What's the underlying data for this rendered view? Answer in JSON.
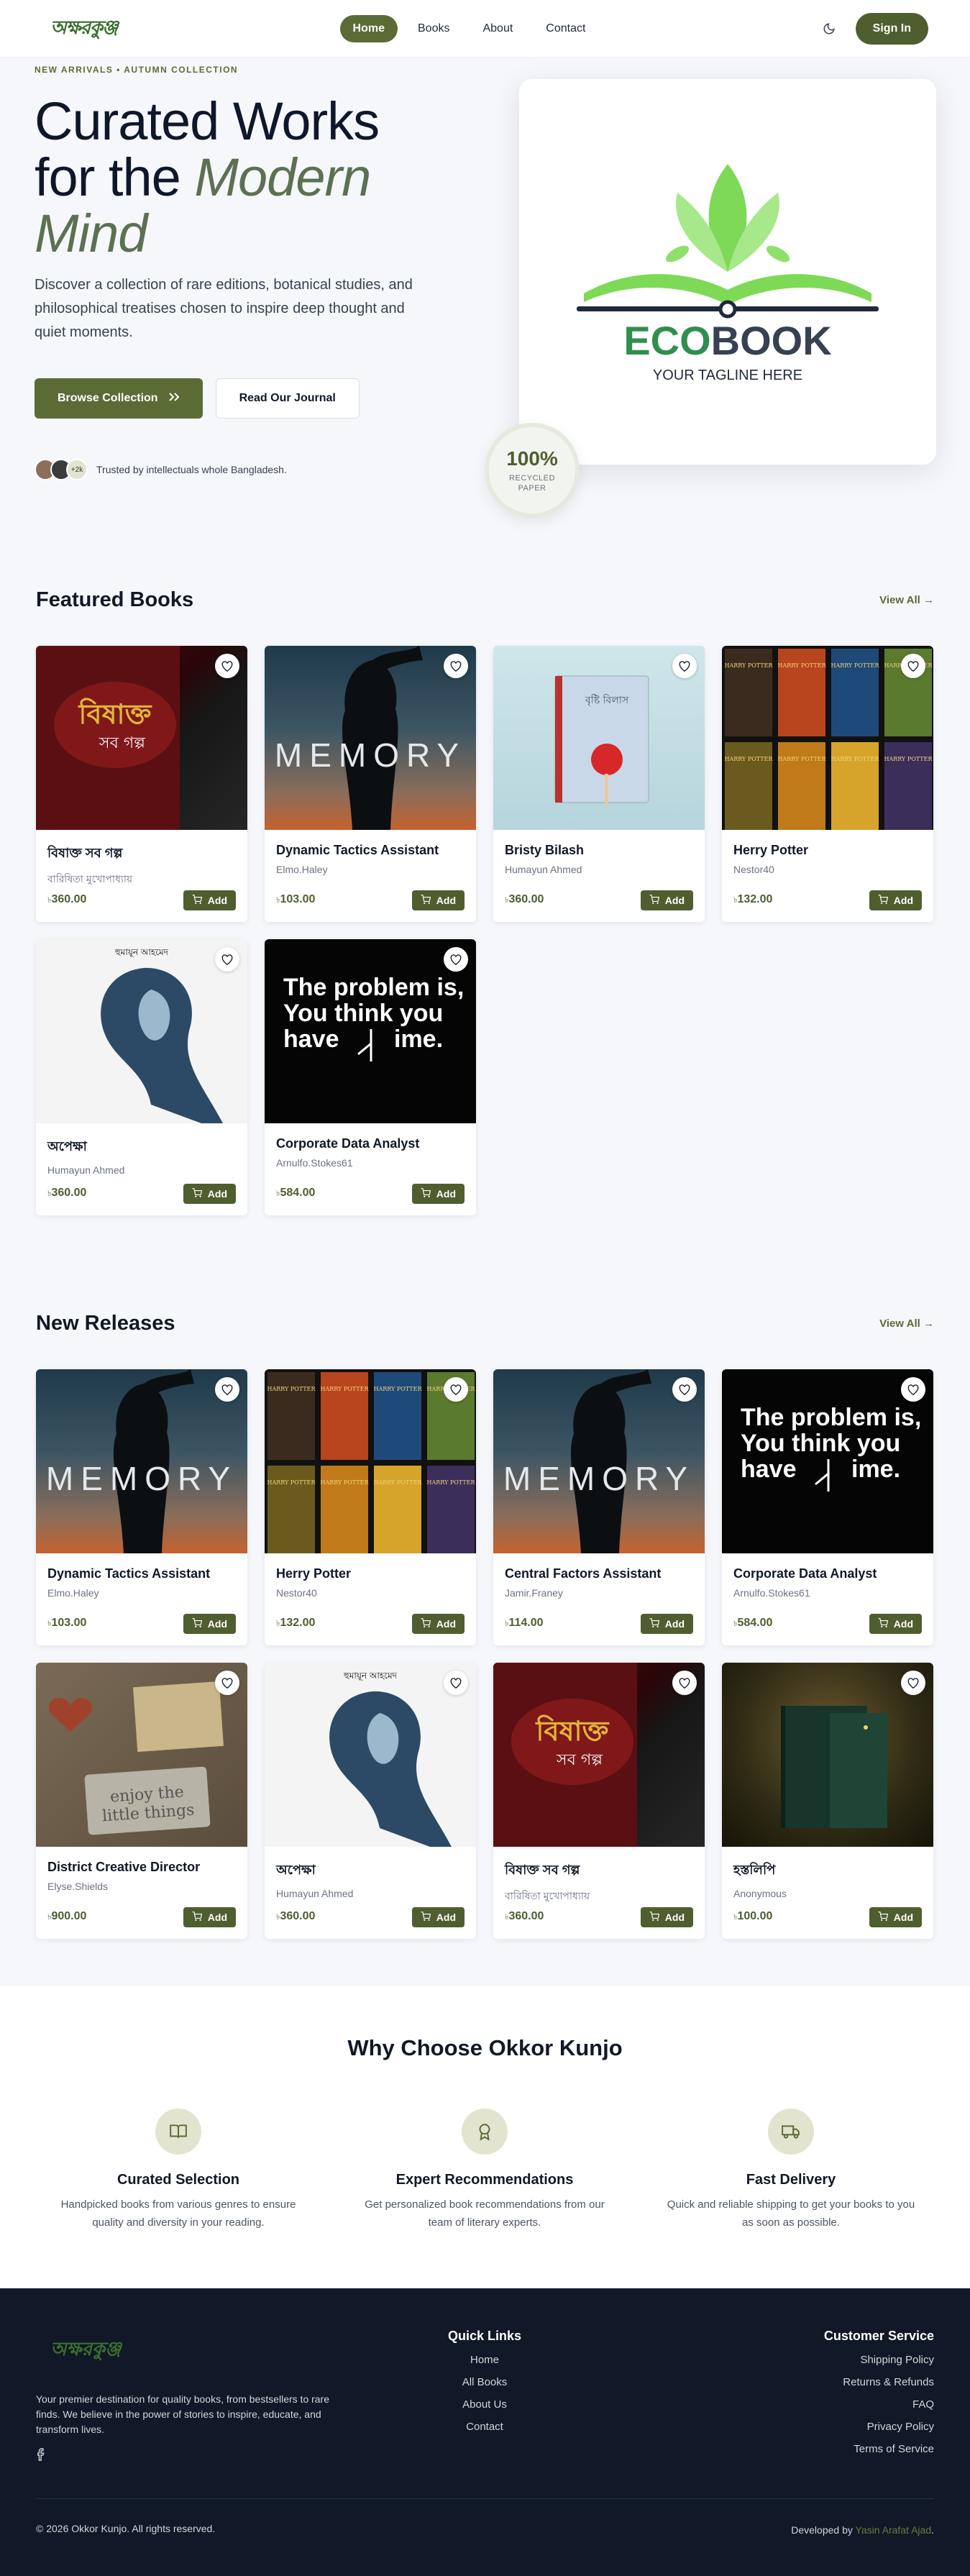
{
  "nav": {
    "logo_text": "অক্ষরকুঞ্জ",
    "links": [
      "Home",
      "Books",
      "About",
      "Contact"
    ],
    "active": "Home",
    "signin": "Sign In"
  },
  "hero": {
    "eyebrow": "NEW ARRIVALS • AUTUMN COLLECTION",
    "title_line1": "Curated Works",
    "title_line2": "for the",
    "title_accent1": "Modern",
    "title_accent2": "Mind",
    "subtitle": "Discover a collection of rare editions, botanical studies, and philosophical treatises chosen to inspire deep thought and quiet moments.",
    "primary_btn": "Browse Collection",
    "secondary_btn": "Read Our Journal",
    "avatar_more": "+2k",
    "trust_text": "Trusted by intellectuals whole Bangladesh.",
    "logo_brand_a": "ECO",
    "logo_brand_b": "BOOK",
    "logo_tagline": "YOUR TAGLINE HERE",
    "badge_num": "100%",
    "badge_label_1": "RECYCLED",
    "badge_label_2": "PAPER"
  },
  "featured": {
    "title": "Featured Books",
    "view_all": "View All →",
    "books": [
      {
        "title": "বিষাক্ত সব গল্প",
        "author": "বারিষিতা মুখোপাধ্যায়",
        "price": "360.00",
        "cover": "c-red"
      },
      {
        "title": "Dynamic Tactics Assistant",
        "author": "Elmo.Haley",
        "price": "103.00",
        "cover": "c-mem"
      },
      {
        "title": "Bristy Bilash",
        "author": "Humayun Ahmed",
        "price": "360.00",
        "cover": "c-blue"
      },
      {
        "title": "Herry Potter",
        "author": "Nestor40",
        "price": "132.00",
        "cover": "c-hp"
      },
      {
        "title": "অপেক্ষা",
        "author": "Humayun Ahmed",
        "price": "360.00",
        "cover": "c-ink"
      },
      {
        "title": "Corporate Data Analyst",
        "author": "Arnulfo.Stokes61",
        "price": "584.00",
        "cover": "c-black"
      }
    ]
  },
  "releases": {
    "title": "New Releases",
    "view_all": "View All →",
    "books": [
      {
        "title": "Dynamic Tactics Assistant",
        "author": "Elmo.Haley",
        "price": "103.00",
        "cover": "c-mem"
      },
      {
        "title": "Herry Potter",
        "author": "Nestor40",
        "price": "132.00",
        "cover": "c-hp"
      },
      {
        "title": "Central Factors Assistant",
        "author": "Jamir.Franey",
        "price": "114.00",
        "cover": "c-mem"
      },
      {
        "title": "Corporate Data Analyst",
        "author": "Arnulfo.Stokes61",
        "price": "584.00",
        "cover": "c-black"
      },
      {
        "title": "District Creative Director",
        "author": "Elyse.Shields",
        "price": "900.00",
        "cover": "c-wood"
      },
      {
        "title": "অপেক্ষা",
        "author": "Humayun Ahmed",
        "price": "360.00",
        "cover": "c-ink"
      },
      {
        "title": "বিষাক্ত সব গল্প",
        "author": "বারিষিতা মুখোপাধ্যায়",
        "price": "360.00",
        "cover": "c-red"
      },
      {
        "title": "হস্তলিপি",
        "author": "Anonymous",
        "price": "100.00",
        "cover": "c-forest"
      }
    ]
  },
  "cover_text": {
    "memory": "MEMORY",
    "problem_1": "The problem is,",
    "problem_2": "You think you",
    "problem_3": "have",
    "problem_4": "ime.",
    "red_title_1": "বিষাক্ত",
    "red_title_2": "সব গল্প",
    "enjoy_1": "enjoy the",
    "enjoy_2": "little things",
    "bristy": "বৃষ্টি বিলাস",
    "opekkha": "হুমায়ূন আহমেদ",
    "hp": "HARRY POTTER"
  },
  "card_ui": {
    "add_label": "Add",
    "currency": "৳"
  },
  "why": {
    "title": "Why Choose Okkor Kunjo",
    "features": [
      {
        "title": "Curated Selection",
        "desc": "Handpicked books from various genres to ensure quality and diversity in your reading."
      },
      {
        "title": "Expert Recommendations",
        "desc": "Get personalized book recommendations from our team of literary experts."
      },
      {
        "title": "Fast Delivery",
        "desc": "Quick and reliable shipping to get your books to you as soon as possible."
      }
    ]
  },
  "footer": {
    "logo_text": "অক্ষরকুঞ্জ",
    "about": "Your premier destination for quality books, from bestsellers to rare finds. We believe in the power of stories to inspire, educate, and transform lives.",
    "quick_links_title": "Quick Links",
    "quick_links": [
      "Home",
      "All Books",
      "About Us",
      "Contact"
    ],
    "service_title": "Customer Service",
    "service_links": [
      "Shipping Policy",
      "Returns & Refunds",
      "FAQ",
      "Privacy Policy",
      "Terms of Service"
    ],
    "copyright": "© 2026 Okkor Kunjo. All rights reserved.",
    "dev_prefix": "Developed by",
    "dev_name": "Yasin Arafat Ajad",
    "dev_suffix": "."
  }
}
